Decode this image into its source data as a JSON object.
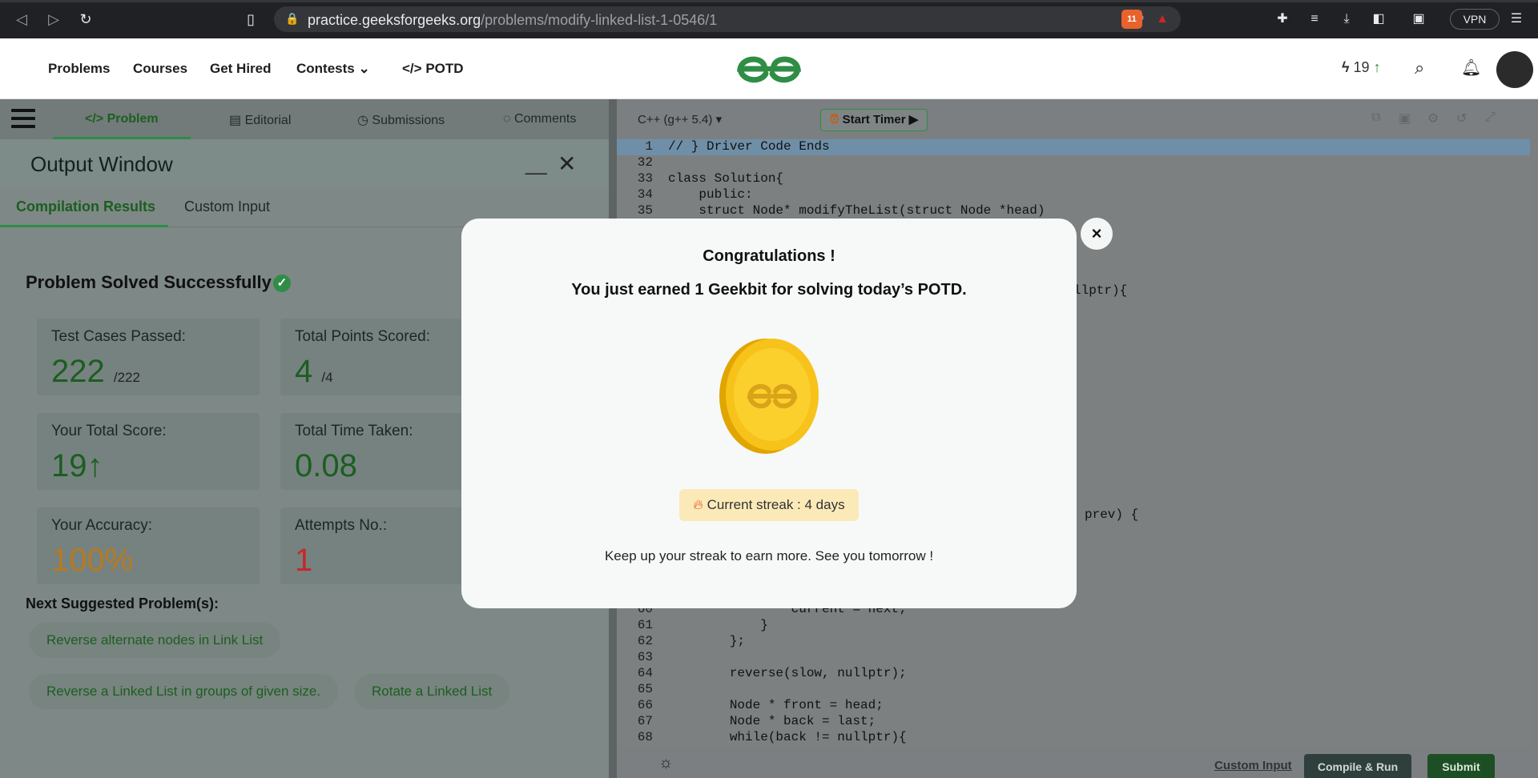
{
  "browser": {
    "url_host": "practice.geeksforgeeks.org",
    "url_path": "/problems/modify-linked-list-1-0546/1",
    "vpn_label": "VPN",
    "brave_badge": "11"
  },
  "header": {
    "nav": [
      "Problems",
      "Courses",
      "Get Hired",
      "Contests",
      "POTD"
    ],
    "streak_count": "19"
  },
  "problem_tabs": [
    "Problem",
    "Editorial",
    "Submissions",
    "Comments"
  ],
  "output": {
    "title": "Output Window",
    "tabs": [
      "Compilation Results",
      "Custom Input"
    ],
    "solved": "Problem Solved Successfully",
    "cards": [
      {
        "label": "Test Cases Passed:",
        "value": "222",
        "suffix": "/222"
      },
      {
        "label": "Total Points Scored:",
        "value": "4",
        "suffix": "/4"
      },
      {
        "label": "Your Total Score:",
        "value": "19",
        "suffix": ""
      },
      {
        "label": "Total Time Taken:",
        "value": "0.08",
        "suffix": ""
      },
      {
        "label": "Your Accuracy:",
        "value": "100%",
        "suffix": ""
      },
      {
        "label": "Attempts No.:",
        "value": "1",
        "suffix": ""
      }
    ],
    "next_title": "Next Suggested Problem(s):",
    "suggestions": [
      "Reverse alternate nodes in Link List",
      "Reverse a Linked List in groups of given size.",
      "Rotate a Linked List"
    ]
  },
  "editor": {
    "language": "C++ (g++ 5.4)",
    "timer": "Start Timer",
    "lines": [
      {
        "n": "1",
        "t": "// } Driver Code Ends"
      },
      {
        "n": "32",
        "t": ""
      },
      {
        "n": "33",
        "t": "class Solution{"
      },
      {
        "n": "34",
        "t": "    public:"
      },
      {
        "n": "35",
        "t": "    struct Node* modifyTheList(struct Node *head)"
      },
      {
        "n": "60",
        "t": "                current = next;"
      },
      {
        "n": "61",
        "t": "            }"
      },
      {
        "n": "62",
        "t": "        };"
      },
      {
        "n": "63",
        "t": ""
      },
      {
        "n": "64",
        "t": "        reverse(slow, nullptr);"
      },
      {
        "n": "65",
        "t": ""
      },
      {
        "n": "66",
        "t": "        Node * front = head;"
      },
      {
        "n": "67",
        "t": "        Node * back = last;"
      },
      {
        "n": "68",
        "t": "        while(back != nullptr){"
      }
    ],
    "fragment_a": "llptr){",
    "fragment_b": "prev) {",
    "custom_input": "Custom Input",
    "compile": "Compile & Run",
    "submit": "Submit"
  },
  "modal": {
    "title": "Congratulations !",
    "subtitle": "You just earned 1 Geekbit for solving today’s POTD.",
    "streak": "Current streak : 4 days",
    "footer": "Keep up your streak to earn more. See you tomorrow !",
    "close": "×"
  }
}
